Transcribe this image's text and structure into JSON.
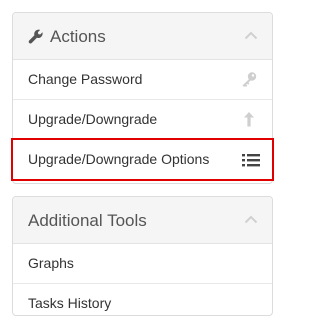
{
  "actions_panel": {
    "title": "Actions",
    "items": [
      {
        "label": "Change Password",
        "icon": "key-icon"
      },
      {
        "label": "Upgrade/Downgrade",
        "icon": "arrow-up-icon"
      },
      {
        "label": "Upgrade/Downgrade Options",
        "icon": "list-icon",
        "highlighted": true
      }
    ]
  },
  "tools_panel": {
    "title": "Additional Tools",
    "items": [
      {
        "label": "Graphs"
      },
      {
        "label": "Tasks History"
      }
    ]
  },
  "colors": {
    "highlight_border": "#e00000",
    "heading_bg": "#f5f5f5",
    "icon_muted": "#cfcfcf",
    "icon_dark": "#444444"
  }
}
